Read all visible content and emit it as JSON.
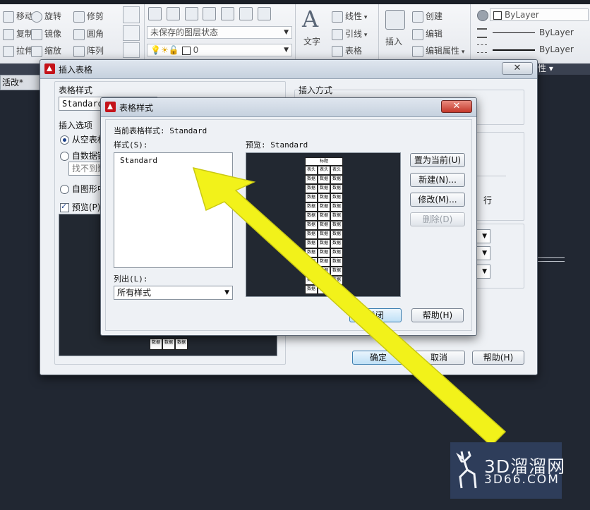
{
  "ribbon": {
    "modify": {
      "move": "移动",
      "rotate": "旋转",
      "trim": "修剪",
      "copy": "复制",
      "mirror": "镜像",
      "fillet": "圆角",
      "stretch": "拉伸",
      "scale": "缩放",
      "array": "阵列"
    },
    "layers": {
      "state_label": "未保存的图层状态",
      "layer_value": "0"
    },
    "annotation": {
      "text": "文字",
      "dimension": "线性",
      "leader": "引线",
      "table": "表格"
    },
    "block": {
      "insert": "插入",
      "create": "创建",
      "edit": "编辑",
      "edit_attributes": "编辑属性"
    },
    "properties": {
      "color": "ByLayer",
      "linetype": "ByLayer",
      "lineweight": "ByLayer",
      "panel_partial": "性"
    }
  },
  "drawing_tab": "活改*",
  "insert_table_dialog": {
    "title": "插入表格",
    "table_style_label": "表格样式",
    "table_style_value": "Standard",
    "insert_options_label": "插入选项",
    "opt_empty": "从空表格",
    "opt_data": "自数据链",
    "data_link_placeholder": "找不到数",
    "opt_drawing": "自图形中",
    "preview_label": "预览(P)",
    "insert_method_label": "插入方式",
    "rows_partial": "行",
    "ok": "确定",
    "cancel": "取消",
    "help": "帮助(H)",
    "preview_cells": [
      "数据",
      "数据",
      "数据"
    ]
  },
  "table_style_dialog": {
    "title": "表格样式",
    "current_style_label": "当前表格样式: Standard",
    "styles_label": "样式(S):",
    "style_items": [
      "Standard"
    ],
    "list_label": "列出(L):",
    "list_value": "所有样式",
    "preview_label": "预览: Standard",
    "preview_title": "标题",
    "preview_headers": [
      "表头",
      "表头",
      "表头"
    ],
    "preview_cell": "数据",
    "btn_set_current": "置为当前(U)",
    "btn_new": "新建(N)...",
    "btn_modify": "修改(M)...",
    "btn_delete": "删除(D)",
    "btn_close": "关闭",
    "btn_help": "帮助(H)"
  },
  "watermark": {
    "brand": "3D溜溜网",
    "domain": "3D66.COM"
  },
  "colors": {
    "arrow": "#f2f21a",
    "canvas_bg": "#212732",
    "logo_bg": "#2e3d5a"
  }
}
